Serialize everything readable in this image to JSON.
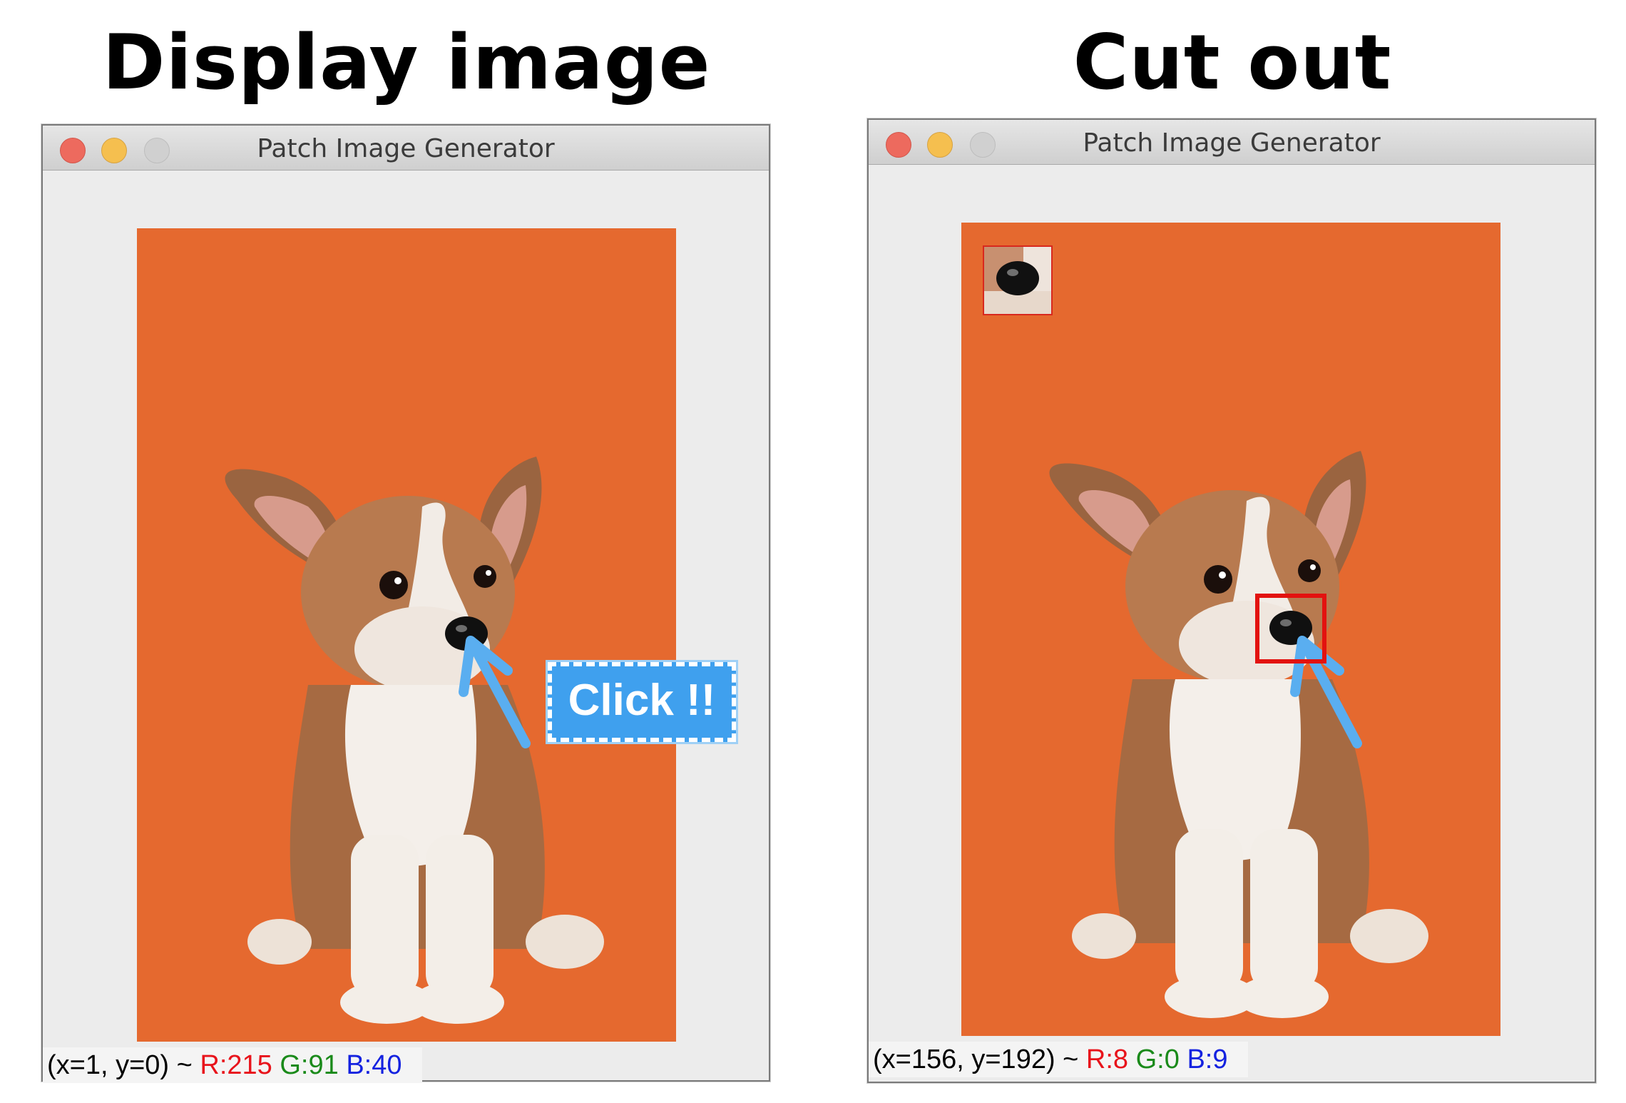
{
  "headings": {
    "left": "Display image",
    "right": "Cut out"
  },
  "window": {
    "title": "Patch Image Generator"
  },
  "left_panel": {
    "status": {
      "coords": "(x=1, y=0) ~ ",
      "r": "R:215",
      "g": "G:91",
      "b": "B:40"
    },
    "callout": "Click !!"
  },
  "right_panel": {
    "status": {
      "coords": "(x=156, y=192) ~ ",
      "r": "R:8",
      "g": "G:0",
      "b": "B:9"
    }
  },
  "colors": {
    "background": "#e5692f",
    "arrow": "#5aaef0",
    "selection": "#e3120f",
    "status_r": "#e8131b",
    "status_g": "#1a8a1a",
    "status_b": "#1422e0"
  }
}
